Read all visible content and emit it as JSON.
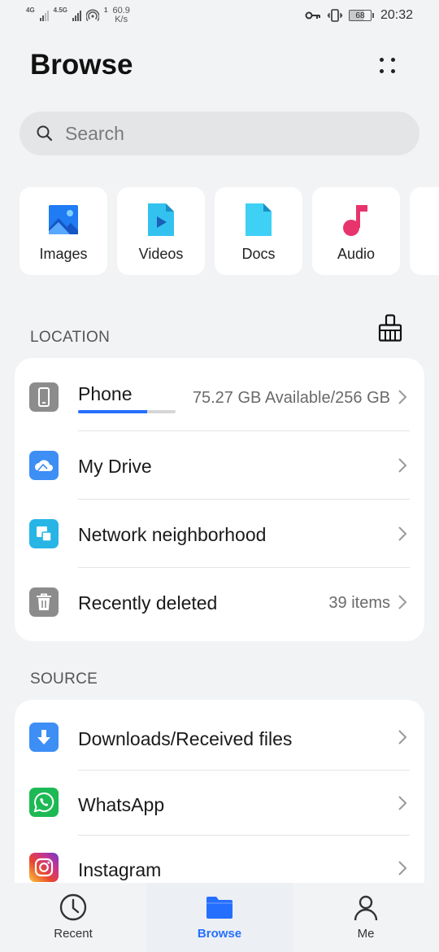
{
  "status_bar": {
    "net1": "4G",
    "net2": "4.5G",
    "hotspot_count": "1",
    "speed_value": "60.9",
    "speed_unit": "K/s",
    "battery": "68",
    "time": "20:32",
    "icons": [
      "signal-icon",
      "signal-icon",
      "hotspot-icon",
      "key-icon",
      "vibrate-icon",
      "battery-icon"
    ]
  },
  "header": {
    "title": "Browse",
    "more_icon": "more-dots-icon"
  },
  "search": {
    "placeholder": "Search",
    "icon": "search-icon"
  },
  "categories": [
    {
      "label": "Images",
      "icon": "images-icon",
      "color": "#1f7cf3"
    },
    {
      "label": "Videos",
      "icon": "videos-icon",
      "color": "#33c2ef"
    },
    {
      "label": "Docs",
      "icon": "docs-icon",
      "color": "#3fd0f5"
    },
    {
      "label": "Audio",
      "icon": "audio-icon",
      "color": "#e8346d"
    }
  ],
  "location": {
    "title": "LOCATION",
    "clean_icon": "broom-icon",
    "items": [
      {
        "label": "Phone",
        "info": "75.27 GB Available/256 GB",
        "icon": "phone-icon",
        "icon_color": "#8c8c8c",
        "storage_used_fraction": 0.71
      },
      {
        "label": "My Drive",
        "info": "",
        "icon": "cloud-icon",
        "icon_color": "#3d8ef5"
      },
      {
        "label": "Network neighborhood",
        "info": "",
        "icon": "network-icon",
        "icon_color": "#27b5e6"
      },
      {
        "label": "Recently deleted",
        "info": "39 items",
        "icon": "trash-icon",
        "icon_color": "#8c8c8c"
      }
    ]
  },
  "source": {
    "title": "SOURCE",
    "items": [
      {
        "label": "Downloads/Received files",
        "icon": "download-icon",
        "icon_color": "#3d8ef5"
      },
      {
        "label": "WhatsApp",
        "icon": "whatsapp-icon",
        "icon_color": "#1db954"
      },
      {
        "label": "Instagram",
        "icon": "instagram-icon",
        "icon_color": "#c8338f"
      }
    ]
  },
  "bottom_nav": [
    {
      "label": "Recent",
      "icon": "clock-icon",
      "active": false
    },
    {
      "label": "Browse",
      "icon": "folder-icon",
      "active": true
    },
    {
      "label": "Me",
      "icon": "person-icon",
      "active": false
    }
  ],
  "colors": {
    "accent": "#256fff",
    "background": "#f1f3f5"
  }
}
